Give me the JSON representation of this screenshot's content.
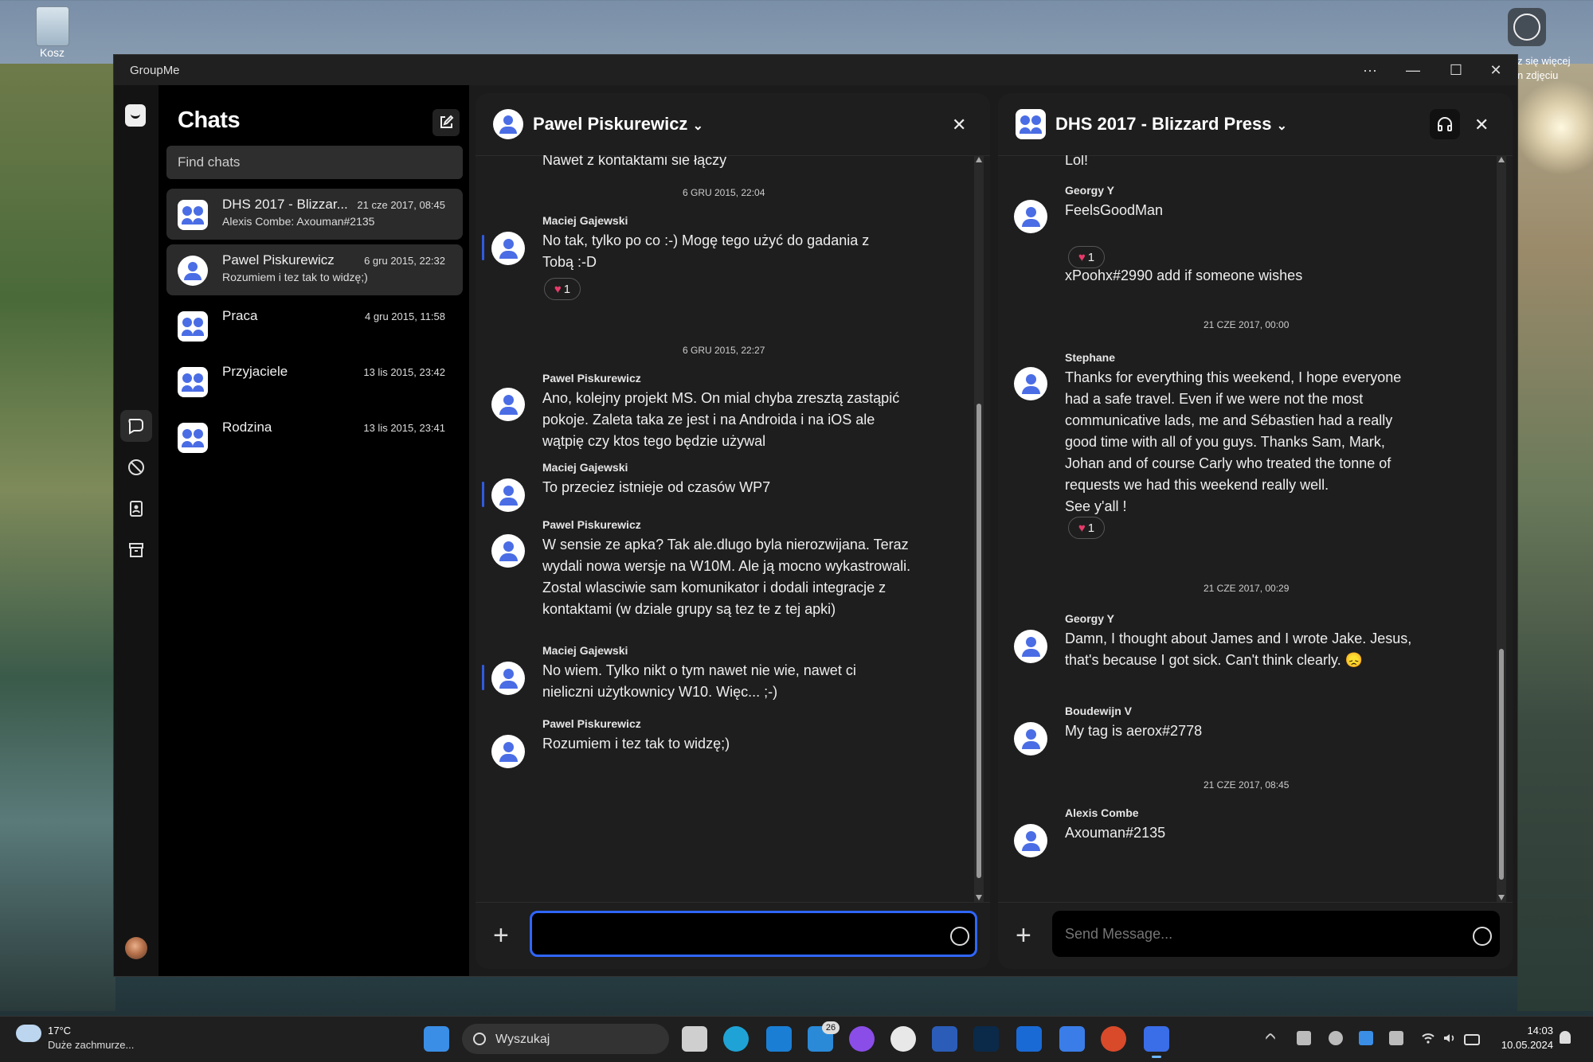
{
  "desktop": {
    "recycle_label": "Kosz",
    "right_hint": "z się więcej\nn zdjęciu"
  },
  "window": {
    "title": "GroupMe",
    "more": "···",
    "minimize": "—",
    "maximize": "☐",
    "close": "✕"
  },
  "sidebar": {
    "heading": "Chats",
    "search_placeholder": "Find chats",
    "chats": [
      {
        "name": "DHS 2017 - Blizzar...",
        "time": "21 cze 2017, 08:45",
        "preview": "Alexis Combe: Axouman#2135",
        "type": "group"
      },
      {
        "name": "Pawel Piskurewicz",
        "time": "6 gru 2015, 22:32",
        "preview": "Rozumiem i tez tak to widzę;)",
        "type": "user"
      },
      {
        "name": "Praca",
        "time": "4 gru 2015, 11:58",
        "preview": "",
        "type": "group"
      },
      {
        "name": "Przyjaciele",
        "time": "13 lis 2015, 23:42",
        "preview": "",
        "type": "group"
      },
      {
        "name": "Rodzina",
        "time": "13 lis 2015, 23:41",
        "preview": "",
        "type": "group"
      }
    ]
  },
  "left_pane": {
    "title": "Pawel Piskurewicz",
    "dropdown": "⌄",
    "close": "✕",
    "top_fragment": "Nawet z kontaktami sie łączy",
    "dates": [
      "6 GRU 2015, 22:04",
      "6 GRU 2015, 22:27"
    ],
    "messages": [
      {
        "author": "Maciej Gajewski",
        "text": "No tak, tylko po co :-) Mogę tego użyć do gadania z Tobą :-D",
        "reaction": "1"
      },
      {
        "author": "Pawel Piskurewicz",
        "text": "Ano, kolejny projekt MS. On mial chyba zresztą zastąpić pokoje. Zaleta taka ze jest i na Androida i na iOS ale wątpię czy ktos tego będzie używal"
      },
      {
        "author": "Maciej Gajewski",
        "text": "To przeciez istnieje od czasów WP7"
      },
      {
        "author": "Pawel Piskurewicz",
        "text": "W sensie ze apka? Tak ale.dlugo byla nierozwijana. Teraz wydali nowa wersje na W10M. Ale ją mocno wykastrowali. Zostal wlasciwie sam komunikator i dodali integracje z kontaktami (w dziale grupy są tez te z tej apki)"
      },
      {
        "author": "Maciej Gajewski",
        "text": "No wiem. Tylko nikt o tym nawet nie wie, nawet ci nieliczni użytkownicy W10. Więc... ;-)"
      },
      {
        "author": "Pawel Piskurewicz",
        "text": "Rozumiem i tez tak to widzę;)"
      }
    ],
    "input_value": "",
    "add": "+"
  },
  "right_pane": {
    "title": "DHS 2017 - Blizzard Press",
    "dropdown": "⌄",
    "close": "✕",
    "top_fragment": "Lol!",
    "dates": [
      "21 CZE 2017, 00:00",
      "21 CZE 2017, 00:29",
      "21 CZE 2017, 08:45"
    ],
    "messages": [
      {
        "author": "Georgy Y",
        "text": "FeelsGoodMan",
        "reaction": "1"
      },
      {
        "author": "",
        "text": "xPoohx#2990 add if someone wishes"
      },
      {
        "author": "Stephane",
        "text": "Thanks for everything this weekend, I hope everyone had a safe travel. Even if we were not the most communicative lads, me and Sébastien had a really good time with all of you guys. Thanks Sam, Mark, Johan and of course Carly who treated the tonne of requests we had this weekend really well.\nSee y'all !",
        "reaction": "1"
      },
      {
        "author": "Georgy Y",
        "text": "Damn, I thought about James and I wrote Jake. Jesus, that's because I got sick. Can't think clearly. 😞"
      },
      {
        "author": "Boudewijn V",
        "text": "My tag is aerox#2778"
      },
      {
        "author": "Alexis Combe",
        "text": "Axouman#2135"
      }
    ],
    "input_placeholder": "Send Message...",
    "add": "+"
  },
  "taskbar": {
    "temperature": "17°C",
    "weather": "Duże zachmurze...",
    "search": "Wyszukaj",
    "badge_count": "26",
    "time": "14:03",
    "date": "10.05.2024"
  },
  "colors": {
    "accent": "#2f66ff",
    "avatar_blue": "#4a6de5",
    "heart": "#e63b6a",
    "app_bg": "#1b1b1b"
  }
}
